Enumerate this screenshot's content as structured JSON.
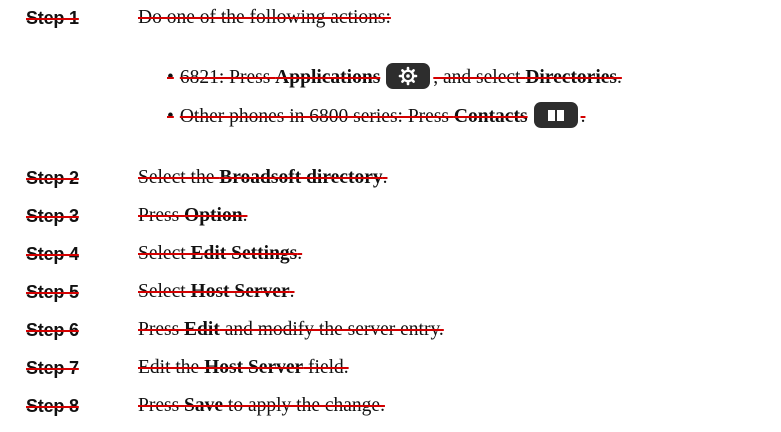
{
  "steps": [
    {
      "label": "Step 1",
      "text": "Do one of the following actions:"
    },
    {
      "label": "Step 2",
      "pre": "Select the ",
      "bold": "Broadsoft directory",
      "post": "."
    },
    {
      "label": "Step 3",
      "pre": "Press ",
      "bold": "Option",
      "post": "."
    },
    {
      "label": "Step 4",
      "pre": "Select ",
      "bold": "Edit Settings",
      "post": "."
    },
    {
      "label": "Step 5",
      "pre": "Select ",
      "bold": "Host Server",
      "post": "."
    },
    {
      "label": "Step 6",
      "pre": "Press ",
      "bold": "Edit",
      "post": " and modify the server entry."
    },
    {
      "label": "Step 7",
      "pre": "Edit the ",
      "bold": "Host Server",
      "post": " field."
    },
    {
      "label": "Step 8",
      "pre": "Press ",
      "bold": "Save",
      "post": " to apply the change."
    }
  ],
  "sub_items": [
    {
      "bullet": "•",
      "pre": "6821: Press ",
      "bold1": "Applications",
      "icon": "gear-icon",
      "mid": ", and select ",
      "bold2": "Directories",
      "post": "."
    },
    {
      "bullet": "•",
      "pre": "Other phones in 6800 series: Press ",
      "bold1": "Contacts",
      "icon": "book-icon",
      "post": "."
    }
  ],
  "colors": {
    "strike": "#d40000",
    "button_bg": "#2d2d2d",
    "text": "#111111"
  }
}
